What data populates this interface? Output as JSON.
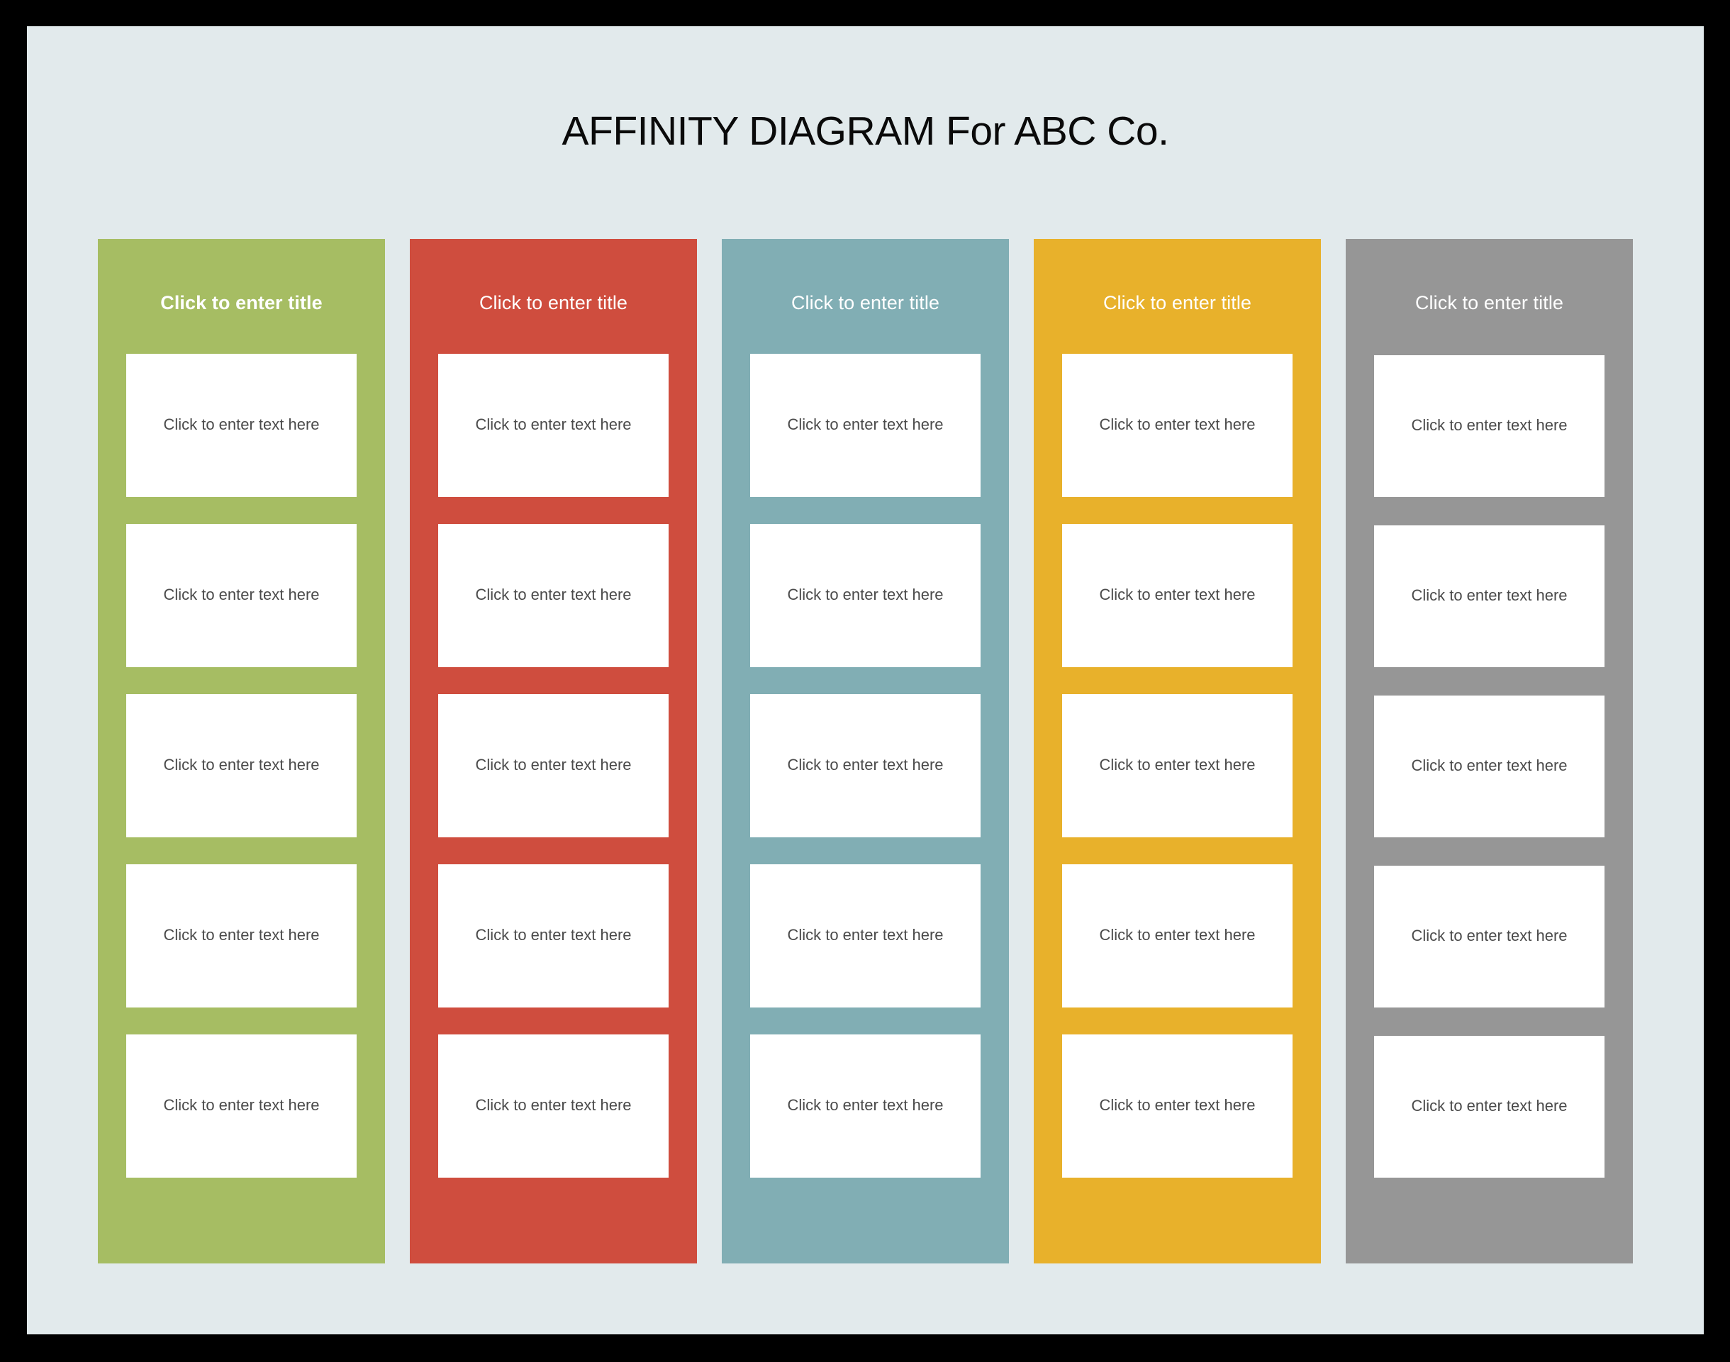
{
  "page": {
    "title": "AFFINITY DIAGRAM For ABC Co.",
    "background_color": "#e2eaec",
    "frame_color": "#000000",
    "title_color": "#0a0a0a"
  },
  "columns": [
    {
      "id": "column-1",
      "color": "#a6bd63",
      "title": "Click to enter title",
      "title_bold": true,
      "cards": [
        {
          "text": "Click to enter text here"
        },
        {
          "text": "Click to enter text here"
        },
        {
          "text": "Click to enter text here"
        },
        {
          "text": "Click to enter text here"
        },
        {
          "text": "Click to enter text here"
        }
      ]
    },
    {
      "id": "column-2",
      "color": "#cf4d3e",
      "title": "Click to enter title",
      "title_bold": false,
      "cards": [
        {
          "text": "Click to enter text here"
        },
        {
          "text": "Click to enter text here"
        },
        {
          "text": "Click to enter text here"
        },
        {
          "text": "Click to enter text here"
        },
        {
          "text": "Click to enter text here"
        }
      ]
    },
    {
      "id": "column-3",
      "color": "#81aeb4",
      "title": "Click to enter title",
      "title_bold": false,
      "cards": [
        {
          "text": "Click to enter text here"
        },
        {
          "text": "Click to enter text here"
        },
        {
          "text": "Click to enter text here"
        },
        {
          "text": "Click to enter text here"
        },
        {
          "text": "Click to enter text here"
        }
      ]
    },
    {
      "id": "column-4",
      "color": "#e8b12b",
      "title": "Click to enter title",
      "title_bold": false,
      "cards": [
        {
          "text": "Click to enter text here"
        },
        {
          "text": "Click to enter text here"
        },
        {
          "text": "Click to enter text here"
        },
        {
          "text": "Click to enter text here"
        },
        {
          "text": "Click to enter text here"
        }
      ]
    },
    {
      "id": "column-5",
      "color": "#969696",
      "title": "Click to enter title",
      "title_bold": false,
      "cards": [
        {
          "text": "Click to enter text here"
        },
        {
          "text": "Click to enter text here"
        },
        {
          "text": "Click to enter text here"
        },
        {
          "text": "Click to enter text here"
        },
        {
          "text": "Click to enter text here"
        }
      ]
    }
  ]
}
